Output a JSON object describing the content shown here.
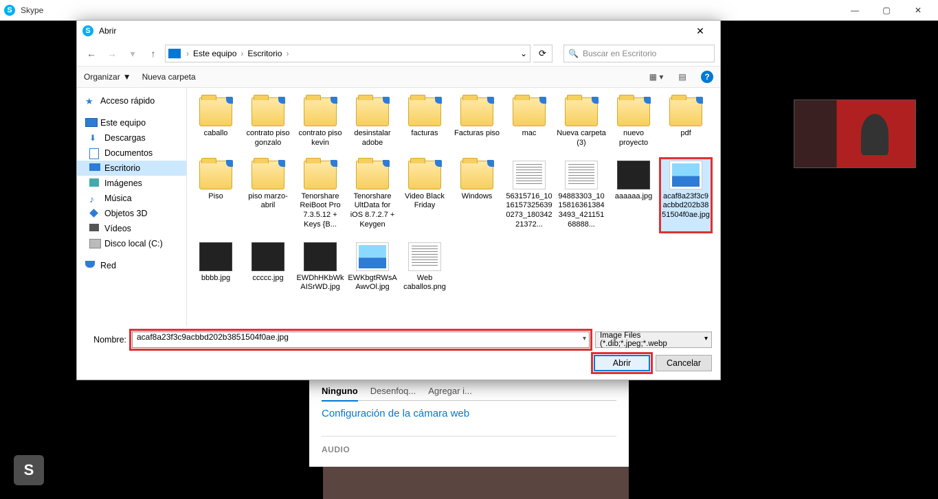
{
  "skype": {
    "title": "Skype",
    "bottom_badge": "S"
  },
  "window_controls": {
    "min": "—",
    "max": "▢",
    "close": "✕"
  },
  "settings": {
    "tabs": [
      "Ninguno",
      "Desenfoq...",
      "Agregar i..."
    ],
    "link": "Configuración de la cámara web",
    "audio": "AUDIO"
  },
  "dialog": {
    "title": "Abrir",
    "breadcrumb": {
      "pc": "Este equipo",
      "loc": "Escritorio",
      "dropdown": "⌄"
    },
    "refresh": "⟳",
    "search_placeholder": "Buscar en Escritorio",
    "toolbar": {
      "organize": "Organizar",
      "new_folder": "Nueva carpeta"
    },
    "sidebar": {
      "quick": "Acceso rápido",
      "pc": "Este equipo",
      "items": [
        "Descargas",
        "Documentos",
        "Escritorio",
        "Imágenes",
        "Música",
        "Objetos 3D",
        "Vídeos",
        "Disco local (C:)"
      ],
      "net": "Red"
    },
    "files": [
      {
        "n": "caballo",
        "t": "folder"
      },
      {
        "n": "contrato piso gonzalo",
        "t": "folder"
      },
      {
        "n": "contrato piso kevin",
        "t": "folder"
      },
      {
        "n": "desinstalar adobe",
        "t": "folder"
      },
      {
        "n": "facturas",
        "t": "folder"
      },
      {
        "n": "Facturas piso",
        "t": "folder"
      },
      {
        "n": "mac",
        "t": "folder"
      },
      {
        "n": "Nueva carpeta (3)",
        "t": "folder"
      },
      {
        "n": "nuevo proyecto",
        "t": "folder"
      },
      {
        "n": "pdf",
        "t": "folder"
      },
      {
        "n": "Piso",
        "t": "folder"
      },
      {
        "n": "piso marzo-abril",
        "t": "folder"
      },
      {
        "n": "Tenorshare ReiBoot Pro 7.3.5.12 + Keys {B...",
        "t": "folder"
      },
      {
        "n": "Tenorshare UltData for iOS 8.7.2.7 + Keygen",
        "t": "folder"
      },
      {
        "n": "Video Black Friday",
        "t": "folder"
      },
      {
        "n": "Windows",
        "t": "folder"
      },
      {
        "n": "56315716_10161573256390273_18034221372...",
        "t": "textdoc"
      },
      {
        "n": "94883303_10158163613843493_42115168888...",
        "t": "textdoc"
      },
      {
        "n": "aaaaaa.jpg",
        "t": "pic"
      },
      {
        "n": "acaf8a23f3c9acbbd202b3851504f0ae.jpg",
        "t": "img",
        "selected": true,
        "highlight": true
      },
      {
        "n": "bbbb.jpg",
        "t": "pic"
      },
      {
        "n": "ccccc.jpg",
        "t": "pic"
      },
      {
        "n": "EWDhHKbWkAISrWD.jpg",
        "t": "pic"
      },
      {
        "n": "EWKbgtRWsAAwvOl.jpg",
        "t": "img"
      },
      {
        "n": "Web caballos.png",
        "t": "textdoc"
      }
    ],
    "footer": {
      "name_label": "Nombre:",
      "filename": "acaf8a23f3c9acbbd202b3851504f0ae.jpg",
      "filter": "Image Files (*.dib;*.jpeg;*.webp",
      "open": "Abrir",
      "cancel": "Cancelar"
    }
  }
}
